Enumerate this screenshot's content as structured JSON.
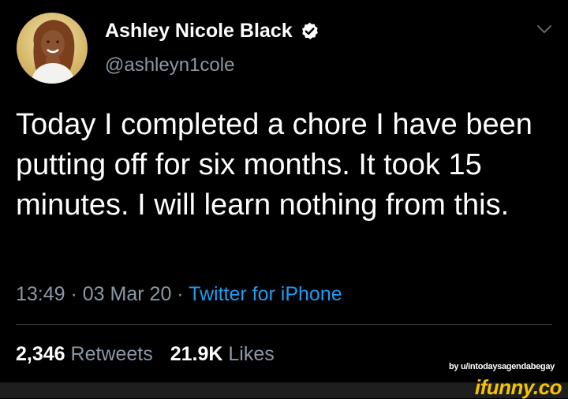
{
  "tweet": {
    "display_name": "Ashley Nicole Black",
    "handle": "@ashleyn1cole",
    "verified": true,
    "text": "Today I completed a chore I have been putting off for six months. It took 15 minutes. I will learn nothing from this.",
    "time": "13:49",
    "date": "03 Mar 20",
    "separator": " · ",
    "source": "Twitter for iPhone",
    "retweets_count": "2,346",
    "retweets_label": "Retweets",
    "likes_count": "21.9K",
    "likes_label": "Likes"
  },
  "watermark": {
    "credit": "by u/intodaysagendabegay",
    "brand": "ifunny.co"
  },
  "icons": {
    "verified": "verified-badge-icon",
    "menu": "chevron-down-icon"
  },
  "colors": {
    "background": "#000000",
    "secondary_text": "#8b98a5",
    "link": "#1d9bf0",
    "brand": "#f5c400"
  }
}
